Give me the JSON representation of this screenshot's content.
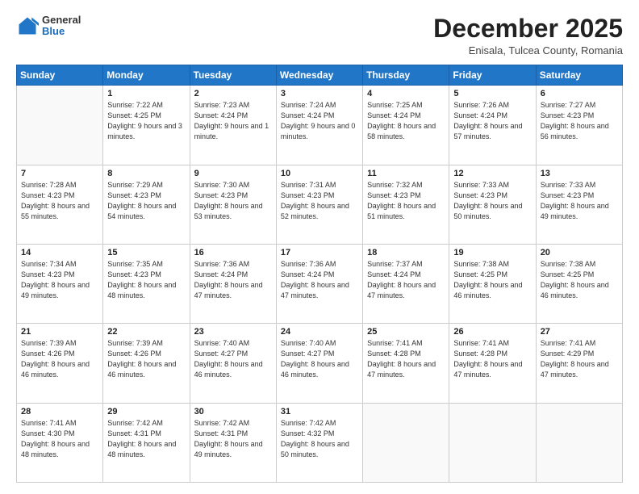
{
  "header": {
    "logo_general": "General",
    "logo_blue": "Blue",
    "month_title": "December 2025",
    "location": "Enisala, Tulcea County, Romania"
  },
  "days_of_week": [
    "Sunday",
    "Monday",
    "Tuesday",
    "Wednesday",
    "Thursday",
    "Friday",
    "Saturday"
  ],
  "weeks": [
    [
      {
        "day": "",
        "sunrise": "",
        "sunset": "",
        "daylight": ""
      },
      {
        "day": "1",
        "sunrise": "Sunrise: 7:22 AM",
        "sunset": "Sunset: 4:25 PM",
        "daylight": "Daylight: 9 hours and 3 minutes."
      },
      {
        "day": "2",
        "sunrise": "Sunrise: 7:23 AM",
        "sunset": "Sunset: 4:24 PM",
        "daylight": "Daylight: 9 hours and 1 minute."
      },
      {
        "day": "3",
        "sunrise": "Sunrise: 7:24 AM",
        "sunset": "Sunset: 4:24 PM",
        "daylight": "Daylight: 9 hours and 0 minutes."
      },
      {
        "day": "4",
        "sunrise": "Sunrise: 7:25 AM",
        "sunset": "Sunset: 4:24 PM",
        "daylight": "Daylight: 8 hours and 58 minutes."
      },
      {
        "day": "5",
        "sunrise": "Sunrise: 7:26 AM",
        "sunset": "Sunset: 4:24 PM",
        "daylight": "Daylight: 8 hours and 57 minutes."
      },
      {
        "day": "6",
        "sunrise": "Sunrise: 7:27 AM",
        "sunset": "Sunset: 4:23 PM",
        "daylight": "Daylight: 8 hours and 56 minutes."
      }
    ],
    [
      {
        "day": "7",
        "sunrise": "Sunrise: 7:28 AM",
        "sunset": "Sunset: 4:23 PM",
        "daylight": "Daylight: 8 hours and 55 minutes."
      },
      {
        "day": "8",
        "sunrise": "Sunrise: 7:29 AM",
        "sunset": "Sunset: 4:23 PM",
        "daylight": "Daylight: 8 hours and 54 minutes."
      },
      {
        "day": "9",
        "sunrise": "Sunrise: 7:30 AM",
        "sunset": "Sunset: 4:23 PM",
        "daylight": "Daylight: 8 hours and 53 minutes."
      },
      {
        "day": "10",
        "sunrise": "Sunrise: 7:31 AM",
        "sunset": "Sunset: 4:23 PM",
        "daylight": "Daylight: 8 hours and 52 minutes."
      },
      {
        "day": "11",
        "sunrise": "Sunrise: 7:32 AM",
        "sunset": "Sunset: 4:23 PM",
        "daylight": "Daylight: 8 hours and 51 minutes."
      },
      {
        "day": "12",
        "sunrise": "Sunrise: 7:33 AM",
        "sunset": "Sunset: 4:23 PM",
        "daylight": "Daylight: 8 hours and 50 minutes."
      },
      {
        "day": "13",
        "sunrise": "Sunrise: 7:33 AM",
        "sunset": "Sunset: 4:23 PM",
        "daylight": "Daylight: 8 hours and 49 minutes."
      }
    ],
    [
      {
        "day": "14",
        "sunrise": "Sunrise: 7:34 AM",
        "sunset": "Sunset: 4:23 PM",
        "daylight": "Daylight: 8 hours and 49 minutes."
      },
      {
        "day": "15",
        "sunrise": "Sunrise: 7:35 AM",
        "sunset": "Sunset: 4:23 PM",
        "daylight": "Daylight: 8 hours and 48 minutes."
      },
      {
        "day": "16",
        "sunrise": "Sunrise: 7:36 AM",
        "sunset": "Sunset: 4:24 PM",
        "daylight": "Daylight: 8 hours and 47 minutes."
      },
      {
        "day": "17",
        "sunrise": "Sunrise: 7:36 AM",
        "sunset": "Sunset: 4:24 PM",
        "daylight": "Daylight: 8 hours and 47 minutes."
      },
      {
        "day": "18",
        "sunrise": "Sunrise: 7:37 AM",
        "sunset": "Sunset: 4:24 PM",
        "daylight": "Daylight: 8 hours and 47 minutes."
      },
      {
        "day": "19",
        "sunrise": "Sunrise: 7:38 AM",
        "sunset": "Sunset: 4:25 PM",
        "daylight": "Daylight: 8 hours and 46 minutes."
      },
      {
        "day": "20",
        "sunrise": "Sunrise: 7:38 AM",
        "sunset": "Sunset: 4:25 PM",
        "daylight": "Daylight: 8 hours and 46 minutes."
      }
    ],
    [
      {
        "day": "21",
        "sunrise": "Sunrise: 7:39 AM",
        "sunset": "Sunset: 4:26 PM",
        "daylight": "Daylight: 8 hours and 46 minutes."
      },
      {
        "day": "22",
        "sunrise": "Sunrise: 7:39 AM",
        "sunset": "Sunset: 4:26 PM",
        "daylight": "Daylight: 8 hours and 46 minutes."
      },
      {
        "day": "23",
        "sunrise": "Sunrise: 7:40 AM",
        "sunset": "Sunset: 4:27 PM",
        "daylight": "Daylight: 8 hours and 46 minutes."
      },
      {
        "day": "24",
        "sunrise": "Sunrise: 7:40 AM",
        "sunset": "Sunset: 4:27 PM",
        "daylight": "Daylight: 8 hours and 46 minutes."
      },
      {
        "day": "25",
        "sunrise": "Sunrise: 7:41 AM",
        "sunset": "Sunset: 4:28 PM",
        "daylight": "Daylight: 8 hours and 47 minutes."
      },
      {
        "day": "26",
        "sunrise": "Sunrise: 7:41 AM",
        "sunset": "Sunset: 4:28 PM",
        "daylight": "Daylight: 8 hours and 47 minutes."
      },
      {
        "day": "27",
        "sunrise": "Sunrise: 7:41 AM",
        "sunset": "Sunset: 4:29 PM",
        "daylight": "Daylight: 8 hours and 47 minutes."
      }
    ],
    [
      {
        "day": "28",
        "sunrise": "Sunrise: 7:41 AM",
        "sunset": "Sunset: 4:30 PM",
        "daylight": "Daylight: 8 hours and 48 minutes."
      },
      {
        "day": "29",
        "sunrise": "Sunrise: 7:42 AM",
        "sunset": "Sunset: 4:31 PM",
        "daylight": "Daylight: 8 hours and 48 minutes."
      },
      {
        "day": "30",
        "sunrise": "Sunrise: 7:42 AM",
        "sunset": "Sunset: 4:31 PM",
        "daylight": "Daylight: 8 hours and 49 minutes."
      },
      {
        "day": "31",
        "sunrise": "Sunrise: 7:42 AM",
        "sunset": "Sunset: 4:32 PM",
        "daylight": "Daylight: 8 hours and 50 minutes."
      },
      {
        "day": "",
        "sunrise": "",
        "sunset": "",
        "daylight": ""
      },
      {
        "day": "",
        "sunrise": "",
        "sunset": "",
        "daylight": ""
      },
      {
        "day": "",
        "sunrise": "",
        "sunset": "",
        "daylight": ""
      }
    ]
  ]
}
